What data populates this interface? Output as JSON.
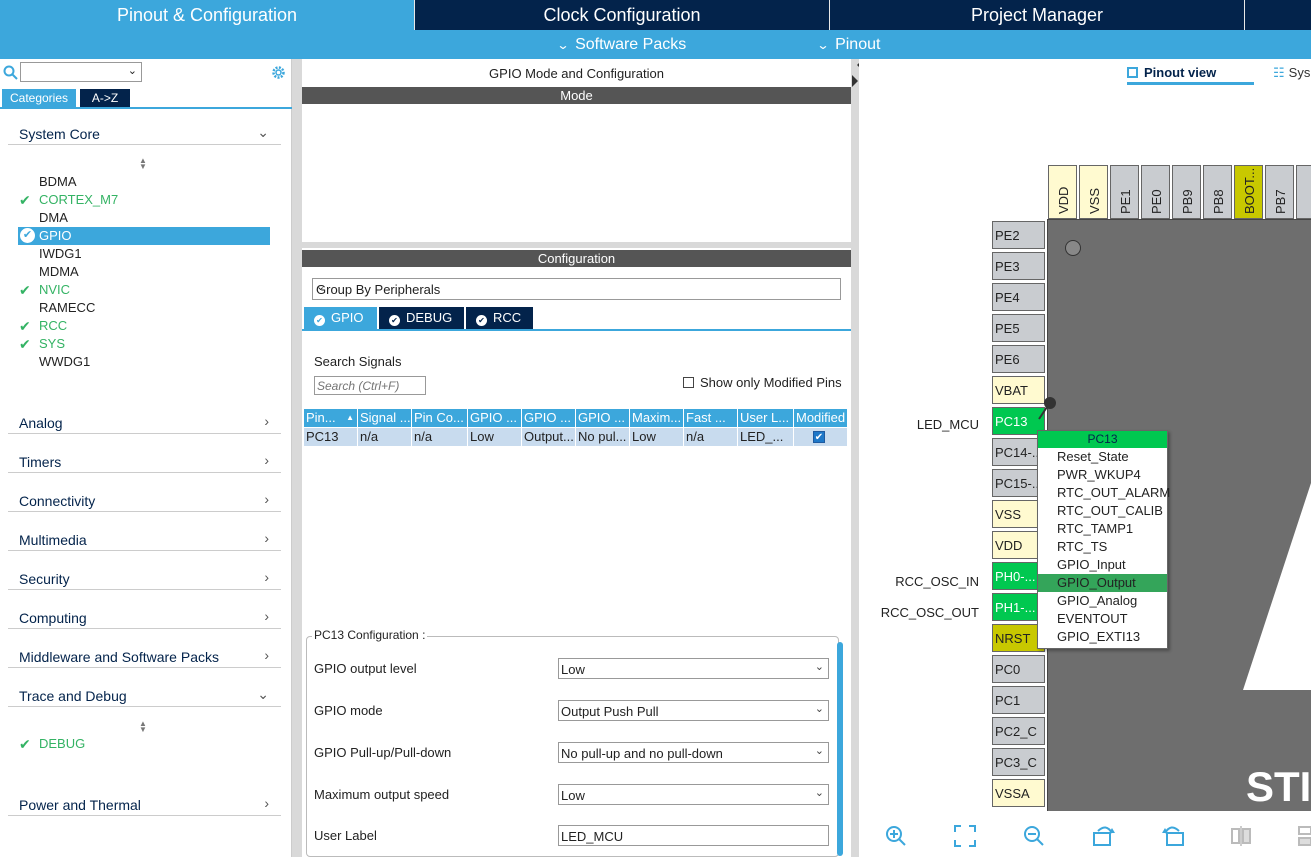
{
  "top_tabs": [
    "Pinout & Configuration",
    "Clock Configuration",
    "Project Manager"
  ],
  "sub_menus": [
    "Software Packs",
    "Pinout"
  ],
  "left": {
    "category_tabs": [
      "Categories",
      "A->Z"
    ],
    "categories": [
      "System Core",
      "Analog",
      "Timers",
      "Connectivity",
      "Multimedia",
      "Security",
      "Computing",
      "Middleware and Software Packs",
      "Trace and Debug",
      "Power and Thermal"
    ],
    "system_core_items": [
      {
        "label": "BDMA",
        "ok": false
      },
      {
        "label": "CORTEX_M7",
        "ok": true
      },
      {
        "label": "DMA",
        "ok": false
      },
      {
        "label": "GPIO",
        "ok": true,
        "selected": true
      },
      {
        "label": "IWDG1",
        "ok": false
      },
      {
        "label": "MDMA",
        "ok": false
      },
      {
        "label": "NVIC",
        "ok": true
      },
      {
        "label": "RAMECC",
        "ok": false
      },
      {
        "label": "RCC",
        "ok": true
      },
      {
        "label": "SYS",
        "ok": true
      },
      {
        "label": "WWDG1",
        "ok": false
      }
    ],
    "trace_items": [
      {
        "label": "DEBUG",
        "ok": true
      }
    ]
  },
  "middle": {
    "title": "GPIO Mode and Configuration",
    "mode_header": "Mode",
    "config_header": "Configuration",
    "group_by": "Group By Peripherals",
    "periph_tabs": [
      "GPIO",
      "DEBUG",
      "RCC"
    ],
    "search_label": "Search Signals",
    "search_placeholder": "Search (Ctrl+F)",
    "show_modified": "Show only Modified Pins",
    "table_headers": [
      "Pin...",
      "Signal ...",
      "Pin Co...",
      "GPIO ...",
      "GPIO ...",
      "GPIO ...",
      "Maxim...",
      "Fast ...",
      "User L...",
      "Modified"
    ],
    "table_row": [
      "PC13",
      "n/a",
      "n/a",
      "Low",
      "Output...",
      "No pul...",
      "Low",
      "n/a",
      "LED_..."
    ],
    "pc13_config_title": "PC13 Configuration :",
    "config_rows": [
      {
        "label": "GPIO output level",
        "value": "Low"
      },
      {
        "label": "GPIO mode",
        "value": "Output Push Pull"
      },
      {
        "label": "GPIO Pull-up/Pull-down",
        "value": "No pull-up and no pull-down"
      },
      {
        "label": "Maximum output speed",
        "value": "Low"
      },
      {
        "label": "User Label",
        "value": "LED_MCU"
      }
    ]
  },
  "right": {
    "view_tabs": [
      "Pinout view",
      "Sys"
    ],
    "top_pins": [
      "VDD",
      "VSS",
      "PE1",
      "PE0",
      "PB9",
      "PB8",
      "BOOT...",
      "PB7"
    ],
    "left_pins": [
      "PE2",
      "PE3",
      "PE4",
      "PE5",
      "PE6",
      "VBAT",
      "PC13",
      "PC14-...",
      "PC15-...",
      "VSS",
      "VDD",
      "PH0-...",
      "PH1-...",
      "NRST",
      "PC0",
      "PC1",
      "PC2_C",
      "PC3_C",
      "VSSA"
    ],
    "signal_labels": {
      "pc13": "LED_MCU",
      "ph0": "RCC_OSC_IN",
      "ph1": "RCC_OSC_OUT"
    },
    "chip_text": "STI",
    "context_menu": {
      "title": "PC13",
      "items": [
        "Reset_State",
        "PWR_WKUP4",
        "RTC_OUT_ALARM",
        "RTC_OUT_CALIB",
        "RTC_TAMP1",
        "RTC_TS",
        "GPIO_Input",
        "GPIO_Output",
        "GPIO_Analog",
        "EVENTOUT",
        "GPIO_EXTI13"
      ],
      "selected": "GPIO_Output"
    }
  }
}
